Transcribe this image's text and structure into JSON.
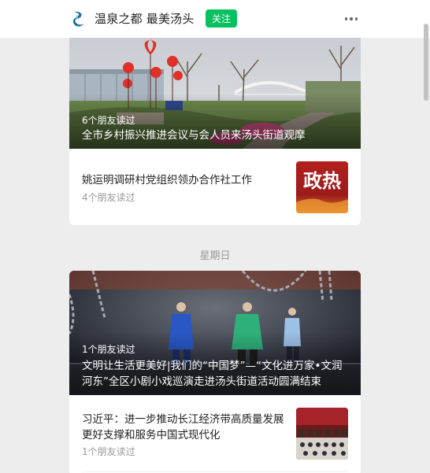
{
  "header": {
    "account_name": "温泉之都 最美汤头",
    "follow_label": "关注",
    "more_icon": "more-horizontal-icon"
  },
  "groups": [
    {
      "date_label": "",
      "hero": {
        "reads": "6个朋友读过",
        "title": "全市乡村振兴推进会议与会人员来汤头街道观摩"
      },
      "items": [
        {
          "title": "姚运明调研村党组织领办合作社工作",
          "reads": "4个朋友读过",
          "thumb_text": "政热"
        }
      ]
    },
    {
      "date_label": "星期日",
      "hero": {
        "reads": "1个朋友读过",
        "title": "文明让生活更美好|我们的“中国梦”—“文化进万家•文润河东”全区小剧小戏巡演走进汤头街道活动圆满结束"
      },
      "items": [
        {
          "title": "习近平：进一步推动长江经济带高质量发展 更好支撑和服务中国式现代化",
          "reads": "1个朋友读过"
        }
      ]
    }
  ],
  "colors": {
    "accent": "#07c160",
    "page_bg": "#ededed",
    "card_bg": "#ffffff",
    "thumb_red": "#9b1b1b"
  }
}
